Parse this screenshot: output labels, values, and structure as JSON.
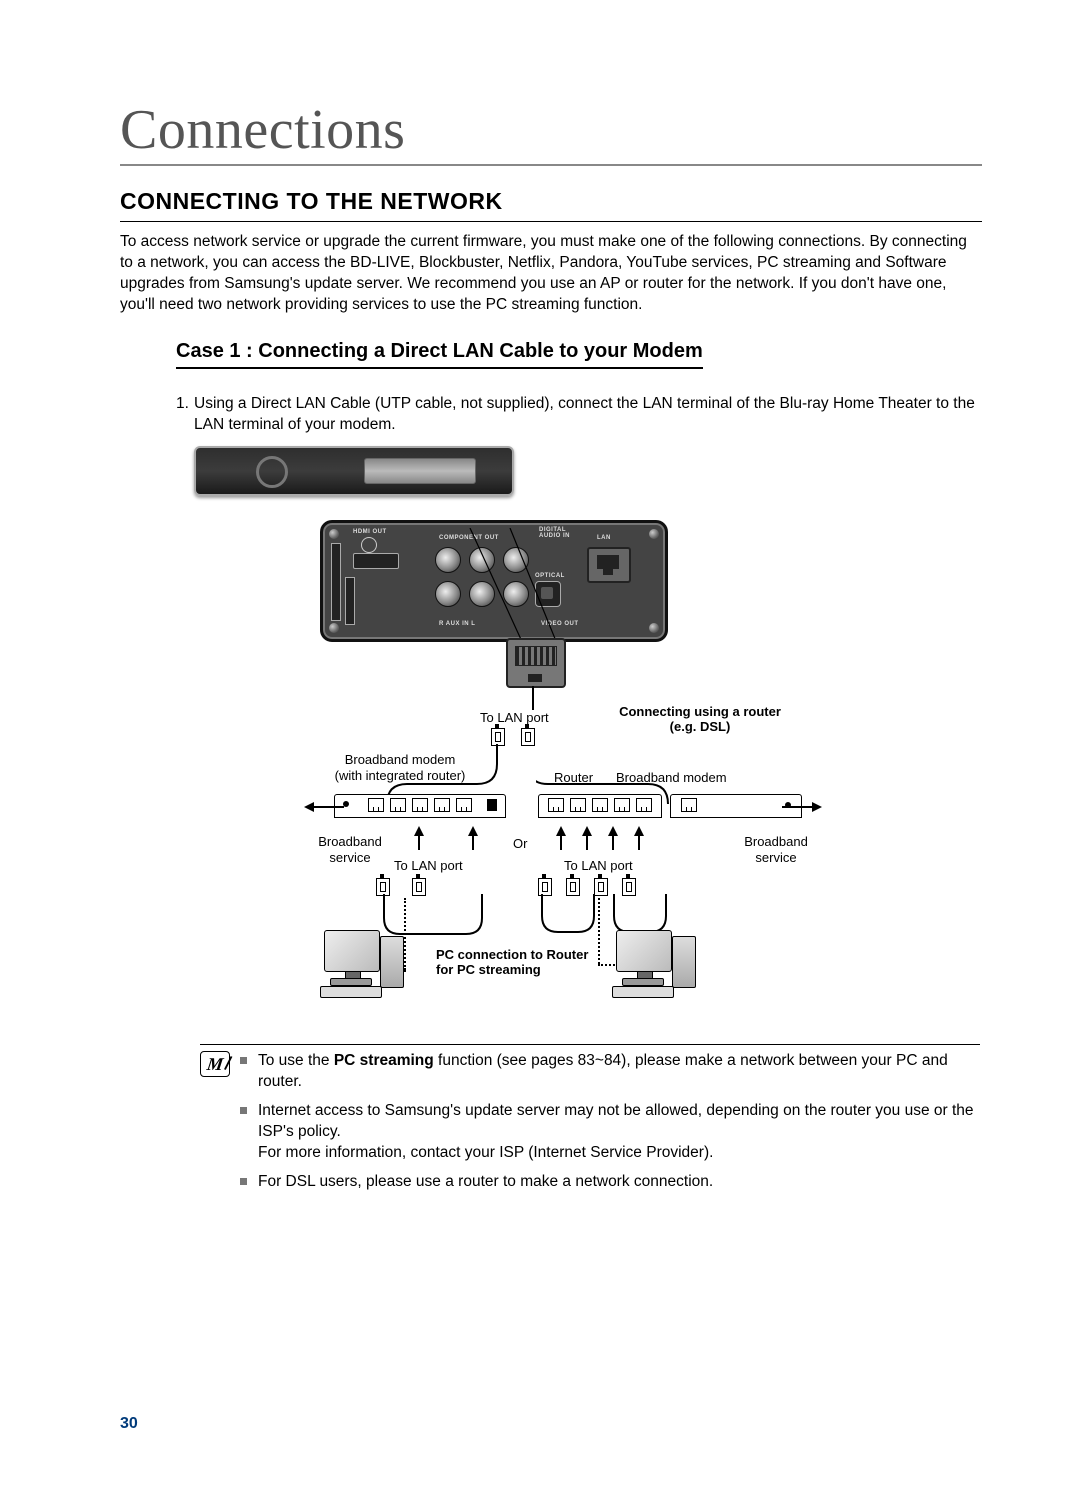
{
  "pageTitle": "Connections",
  "sectionHeading": "CONNECTING TO THE NETWORK",
  "intro": "To access network service or upgrade the current firmware, you must make one of the following connections. By connecting to a network, you can access the BD-LIVE, Blockbuster, Netflix, Pandora, YouTube services, PC streaming and Software upgrades from Samsung's update server. We recommend you use an AP or router for the network. If you don't have one, you'll need two network providing services to use the PC streaming function.",
  "caseHeading": "Case 1 : Connecting a Direct LAN Cable to your Modem",
  "step1Num": "1.",
  "step1Text": "Using a Direct LAN Cable (UTP cable, not supplied), connect the LAN terminal of the Blu-ray Home Theater to the LAN terminal of your modem.",
  "diagram": {
    "backPanel": {
      "hdmiOut": "HDMI OUT",
      "componentOut": "COMPONENT OUT",
      "digital": "DIGITAL",
      "audioIn": "AUDIO IN",
      "lan": "LAN",
      "optical": "OPTICAL",
      "auxIn": "R   AUX IN   L",
      "videoOut": "VIDEO OUT"
    },
    "toLanPort": "To LAN port",
    "connectingRouterLine1": "Connecting using a router",
    "connectingRouterLine2": "(e.g. DSL)",
    "bbModemIntegratedLine1": "Broadband modem",
    "bbModemIntegratedLine2": "(with integrated router)",
    "router": "Router",
    "bbModem": "Broadband modem",
    "or": "Or",
    "broadbandService": "Broadband service",
    "pcConnLine1": "PC connection to Router",
    "pcConnLine2": "for PC streaming"
  },
  "notes": {
    "item1a": "To use the ",
    "item1bold": "PC streaming",
    "item1b": " function (see pages 83~84), please make a network between your PC and router.",
    "item2a": "Internet access to Samsung's update server may not be allowed, depending on the router you use or the ISP's policy.",
    "item2b": "For more information, contact your ISP (Internet Service Provider).",
    "item3": "For DSL users, please use a router to make a network connection."
  },
  "pageNumber": "30"
}
